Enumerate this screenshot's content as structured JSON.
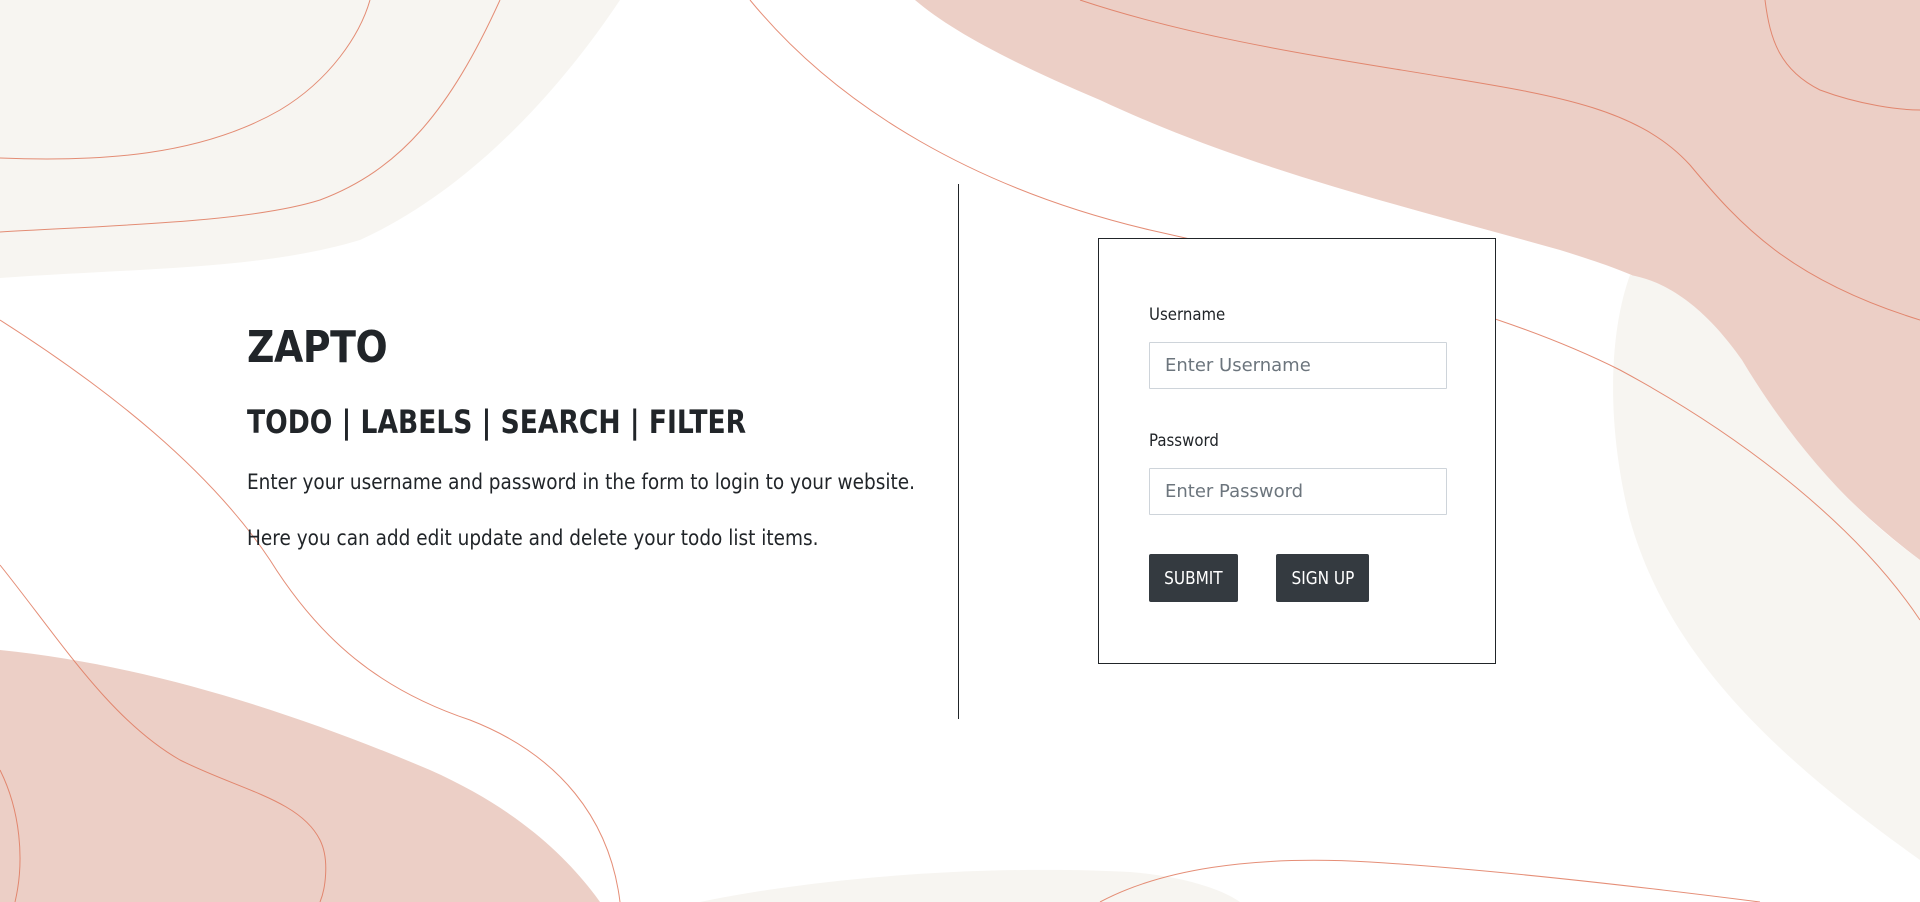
{
  "brand": {
    "title": "ZAPTO"
  },
  "hero": {
    "tagline": "TODO | LABELS | SEARCH | FILTER",
    "lines": [
      "Enter your username and password in the form to login to your website.",
      "Here you can add edit update and delete your todo list items."
    ]
  },
  "login_form": {
    "username": {
      "label": "Username",
      "placeholder": "Enter Username",
      "value": ""
    },
    "password": {
      "label": "Password",
      "placeholder": "Enter Password",
      "value": ""
    },
    "submit_label": "SUBMIT",
    "signup_label": "SIGN UP"
  },
  "theme": {
    "accent_pink": "#eccfc6",
    "accent_line": "#e07a5f",
    "cream": "#f7f5f1",
    "button_bg": "#343a40",
    "text": "#212529"
  }
}
